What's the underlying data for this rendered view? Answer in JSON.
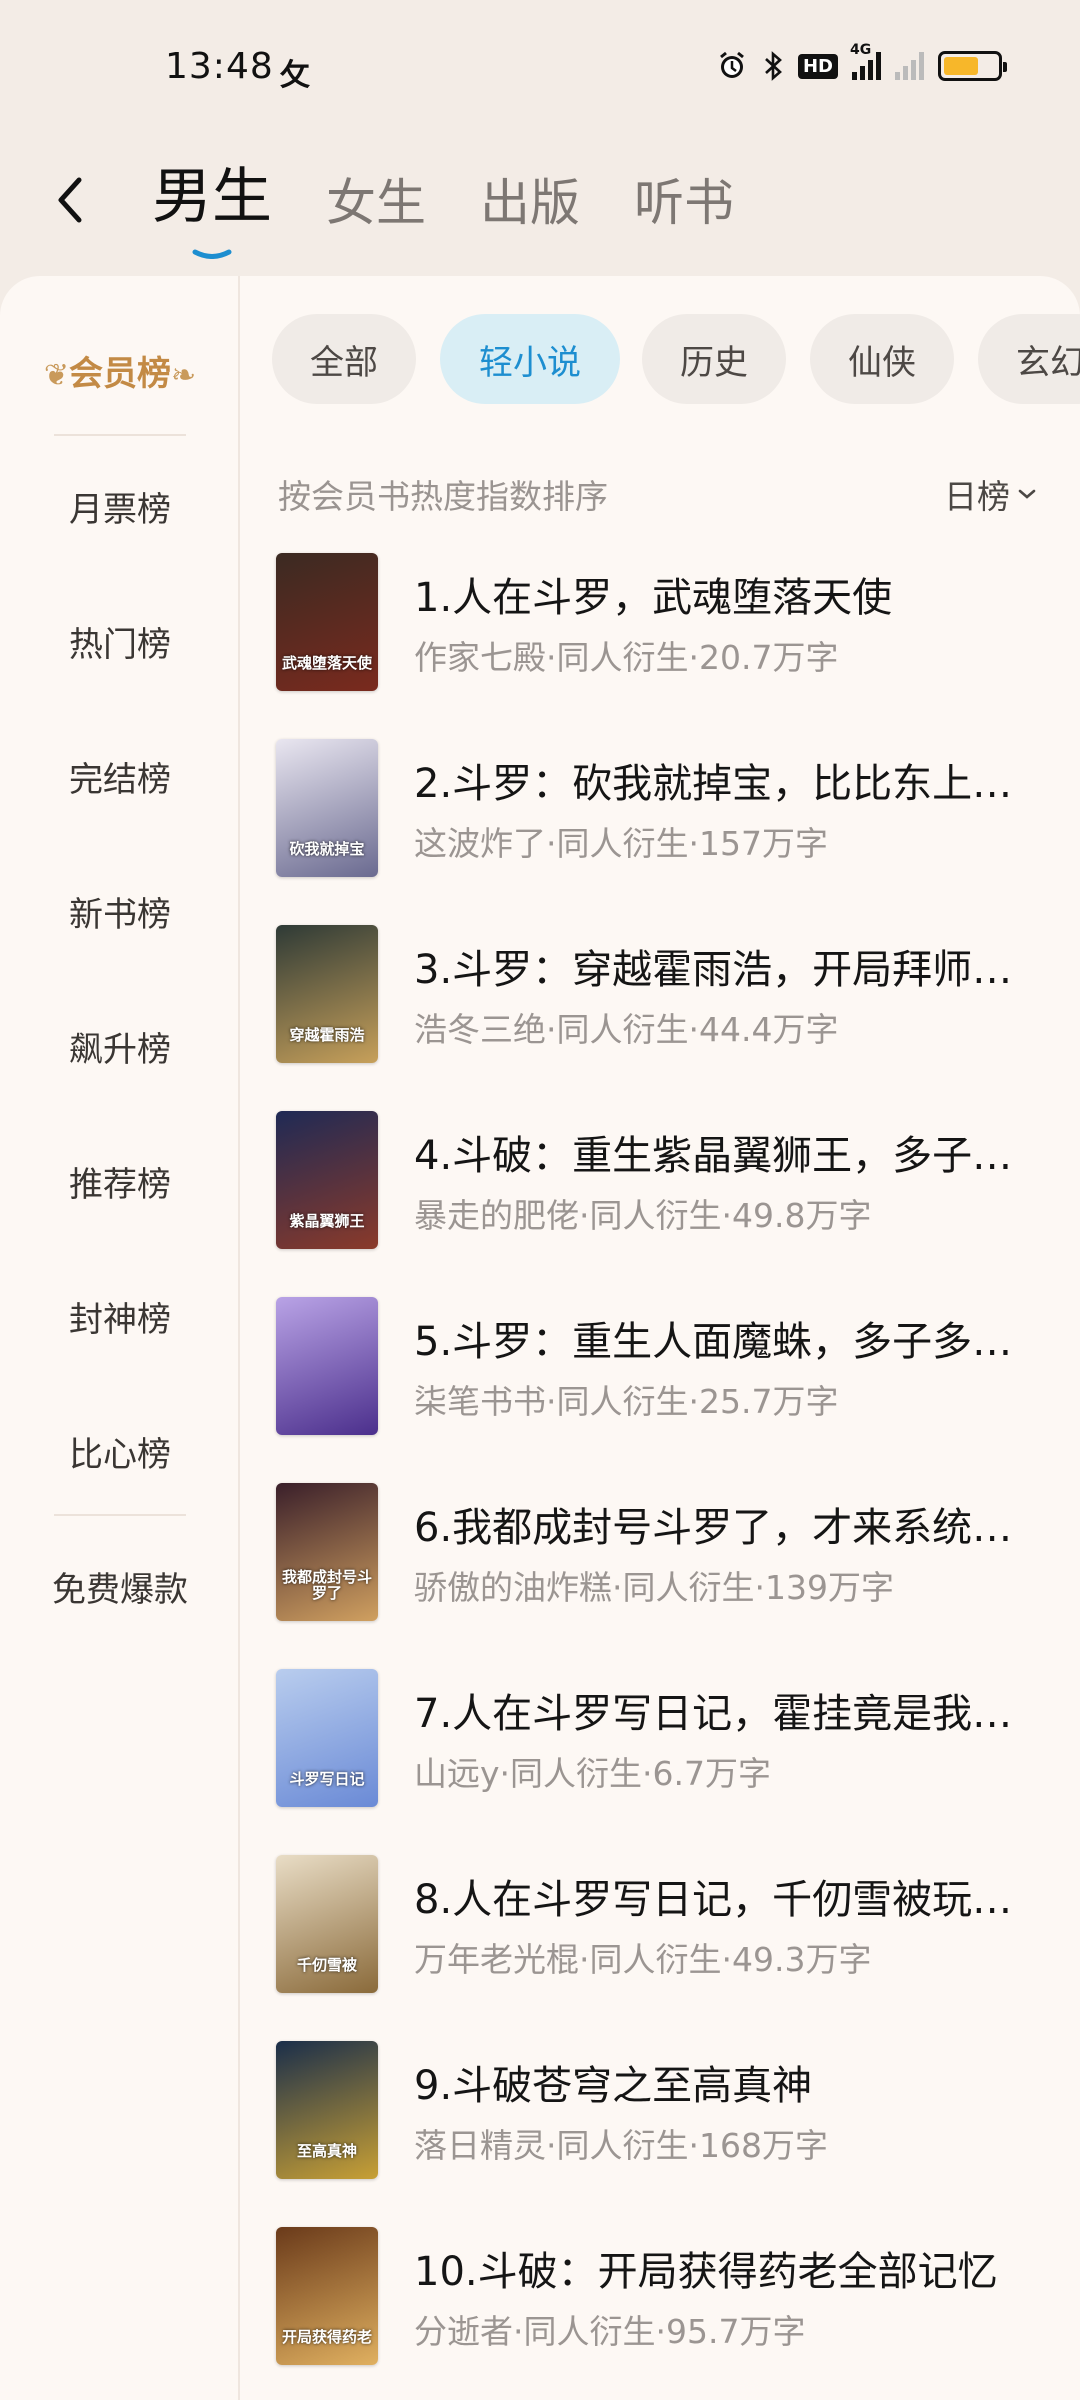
{
  "status_bar": {
    "time": "13:48",
    "notification_glyph": "攵",
    "hd_label": "HD",
    "network_label": "4G",
    "icons": [
      "alarm-icon",
      "bluetooth-icon",
      "hd-icon",
      "signal-4g-icon",
      "signal-icon",
      "battery-icon"
    ],
    "battery_level": 0.65
  },
  "header": {
    "tabs": [
      {
        "label": "男生",
        "active": true
      },
      {
        "label": "女生",
        "active": false
      },
      {
        "label": "出版",
        "active": false
      },
      {
        "label": "听书",
        "active": false
      }
    ]
  },
  "sidebar": {
    "items": [
      {
        "label": "会员榜",
        "active": true
      },
      {
        "label": "月票榜"
      },
      {
        "label": "热门榜"
      },
      {
        "label": "完结榜"
      },
      {
        "label": "新书榜"
      },
      {
        "label": "飙升榜"
      },
      {
        "label": "推荐榜"
      },
      {
        "label": "封神榜"
      },
      {
        "label": "比心榜"
      },
      {
        "label": "免费爆款"
      }
    ]
  },
  "categories": [
    {
      "label": "全部",
      "active": false
    },
    {
      "label": "轻小说",
      "active": true
    },
    {
      "label": "历史",
      "active": false
    },
    {
      "label": "仙侠",
      "active": false
    },
    {
      "label": "玄幻",
      "active": false
    }
  ],
  "sort": {
    "description": "按会员书热度指数排序",
    "period": "日榜"
  },
  "books": [
    {
      "title": "1.人在斗罗，武魂堕落天使",
      "meta": "作家七殿·同人衍生·20.7万字",
      "cover_text": "武魂堕落天使",
      "cover_colors": [
        "#3b2a22",
        "#7a2a1e"
      ]
    },
    {
      "title": "2.斗罗：砍我就掉宝，比比东上…",
      "meta": "这波炸了·同人衍生·157万字",
      "cover_text": "砍我就掉宝",
      "cover_colors": [
        "#e9e6f0",
        "#6a6a90"
      ]
    },
    {
      "title": "3.斗罗：穿越霍雨浩，开局拜师…",
      "meta": "浩冬三绝·同人衍生·44.4万字",
      "cover_text": "穿越霍雨浩",
      "cover_colors": [
        "#2e3a36",
        "#c7a05a"
      ]
    },
    {
      "title": "4.斗破：重生紫晶翼狮王，多子…",
      "meta": "暴走的肥佬·同人衍生·49.8万字",
      "cover_text": "紫晶翼狮王",
      "cover_colors": [
        "#1f2a55",
        "#8a3a2a"
      ]
    },
    {
      "title": "5.斗罗：重生人面魔蛛，多子多…",
      "meta": "柒笔书书·同人衍生·25.7万字",
      "cover_text": "",
      "cover_colors": [
        "#b9a3e6",
        "#4b2f8c"
      ]
    },
    {
      "title": "6.我都成封号斗罗了，才来系统…",
      "meta": "骄傲的油炸糕·同人衍生·139万字",
      "cover_text": "我都成封号斗罗了",
      "cover_colors": [
        "#3a1f2a",
        "#d0a060"
      ]
    },
    {
      "title": "7.人在斗罗写日记，霍挂竟是我…",
      "meta": "山远y·同人衍生·6.7万字",
      "cover_text": "斗罗写日记",
      "cover_colors": [
        "#b9cdee",
        "#6a8ad6"
      ]
    },
    {
      "title": "8.人在斗罗写日记，千仞雪被玩…",
      "meta": "万年老光棍·同人衍生·49.3万字",
      "cover_text": "千仞雪被",
      "cover_colors": [
        "#e9ddc6",
        "#8a6a3a"
      ]
    },
    {
      "title": "9.斗破苍穹之至高真神",
      "meta": "落日精灵·同人衍生·168万字",
      "cover_text": "至高真神",
      "cover_colors": [
        "#1a2e4a",
        "#c8a035"
      ]
    },
    {
      "title": "10.斗破：开局获得药老全部记忆",
      "meta": "分逝者·同人衍生·95.7万字",
      "cover_text": "开局获得药老",
      "cover_colors": [
        "#6a3a1a",
        "#e0b060"
      ]
    }
  ]
}
